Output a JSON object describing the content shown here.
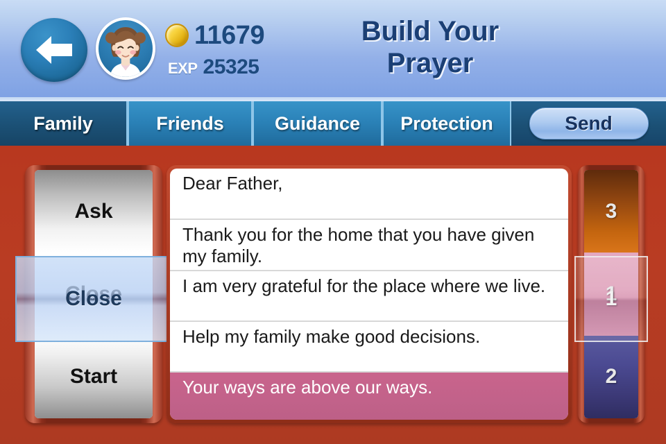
{
  "header": {
    "title": "Build Your\nPrayer",
    "title_line1": "Build Your",
    "title_line2": "Prayer",
    "back_icon": "back-arrow-icon",
    "avatar_icon": "player-avatar-icon",
    "coin_icon": "gold-coin-icon",
    "coin_count": "11679",
    "exp_label": "EXP",
    "exp_count": "25325"
  },
  "tabs": [
    {
      "label": "Family",
      "active": true
    },
    {
      "label": "Friends",
      "active": false
    },
    {
      "label": "Guidance",
      "active": false
    },
    {
      "label": "Protection",
      "active": false
    }
  ],
  "send_button": {
    "label": "Send"
  },
  "left_picker": {
    "options": [
      "Ask",
      "Close",
      "Start"
    ],
    "selected_index": 1,
    "selected_value": "Close"
  },
  "prayer_lines": [
    {
      "text": "Dear Father,",
      "highlight": false
    },
    {
      "text": "Thank you for the home that you have given my family.",
      "highlight": false
    },
    {
      "text": "I am very grateful for the place where we live.",
      "highlight": false
    },
    {
      "text": "Help my family make good decisions.",
      "highlight": false
    },
    {
      "text": "Your ways are above our ways.",
      "highlight": true
    }
  ],
  "right_picker": {
    "options": [
      "3",
      "1",
      "2"
    ],
    "selected_index": 1,
    "selected_value": "1",
    "colors": {
      "3": "#c4650f",
      "1": "#d391af",
      "2": "#3b3875"
    }
  },
  "colors": {
    "background_red": "#b63a22",
    "header_blue": "#93b0e8",
    "tab_blue": "#2b82b8",
    "tab_active_blue": "#1b5075",
    "title_navy": "#1b3f74",
    "highlight_pink": "#c2628a",
    "selection_blue": "#7fb0dd"
  }
}
